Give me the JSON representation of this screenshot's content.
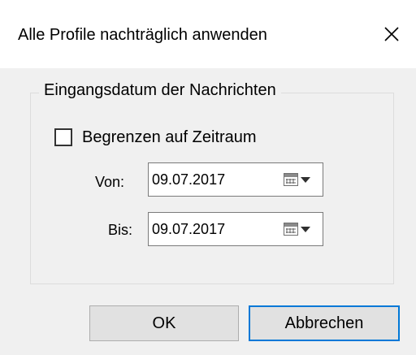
{
  "window": {
    "title": "Alle Profile nachträglich anwenden",
    "close_icon": "close-x"
  },
  "group": {
    "legend": "Eingangsdatum der Nachrichten",
    "checkbox_label": "Begrenzen auf Zeitraum",
    "checkbox_checked": false,
    "from_label": "Von:",
    "from_value": "09.07.2017",
    "to_label": "Bis:",
    "to_value": "09.07.2017",
    "date_picker_icon": "calendar-dropdown"
  },
  "buttons": {
    "ok": "OK",
    "cancel": "Abbrechen",
    "focus_color": "#0078d7"
  }
}
